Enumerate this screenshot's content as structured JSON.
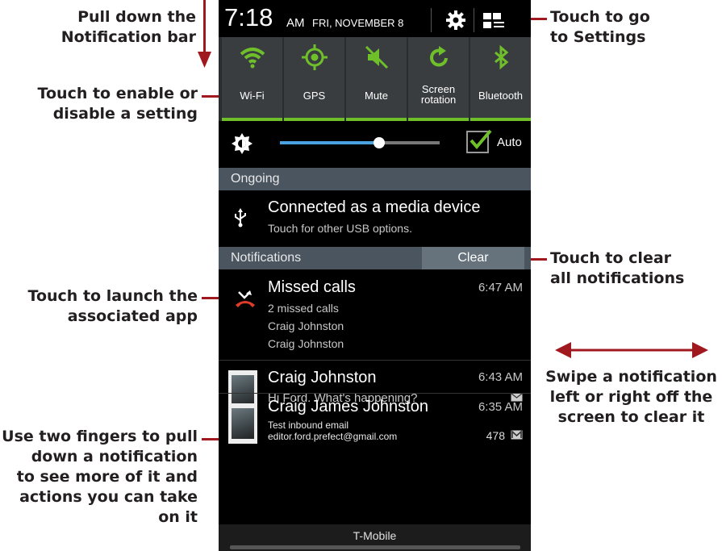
{
  "status_bar": {
    "time": "7:18",
    "ampm": "AM",
    "date": "FRI, NOVEMBER 8",
    "settings_icon": "gear-icon",
    "toggle_icon": "quick-settings-grid-icon"
  },
  "toggles": [
    {
      "label": "Wi-Fi",
      "icon": "wifi-icon"
    },
    {
      "label": "GPS",
      "icon": "gps-icon"
    },
    {
      "label": "Mute",
      "icon": "mute-icon"
    },
    {
      "label": "Screen rotation",
      "icon": "rotation-icon"
    },
    {
      "label": "Bluetooth",
      "icon": "bluetooth-icon"
    }
  ],
  "toggle_color": "#6fbf2a",
  "brightness": {
    "level": 0.62,
    "auto_label": "Auto",
    "auto_checked": true
  },
  "ongoing": {
    "header": "Ongoing",
    "title": "Connected as a media device",
    "subtitle": "Touch for other USB options.",
    "icon": "usb-icon"
  },
  "notifications": {
    "header": "Notifications",
    "clear_label": "Clear",
    "items": [
      {
        "title": "Missed calls",
        "time": "6:47 AM",
        "lines": [
          "2 missed calls",
          "Craig Johnston",
          "Craig Johnston"
        ],
        "icon": "missed-call-icon"
      },
      {
        "title": "Craig Johnston",
        "time": "6:43 AM",
        "lines": [
          "Hi Ford. What's happening?"
        ],
        "icon": "message-icon"
      },
      {
        "title": "Craig James Johnston",
        "time": "6:35 AM",
        "lines": [
          "Test inbound email",
          "editor.ford.prefect@gmail.com"
        ],
        "count": "478",
        "icon": "email-icon"
      }
    ]
  },
  "carrier": "T-Mobile",
  "callouts": {
    "pull_down": "Pull down the\nNotification bar",
    "toggle": "Touch to enable or\ndisable a setting",
    "launch": "Touch to launch the\nassociated app",
    "two_fingers": "Use two fingers to pull\ndown a notification\nto see more of it and\nactions you can take\non it",
    "settings": "Touch to go\nto Settings",
    "clear": "Touch to clear\nall notifications",
    "swipe": "Swipe a notification\nleft or right off the\nscreen to clear it"
  },
  "accent_color": "#a0191e"
}
